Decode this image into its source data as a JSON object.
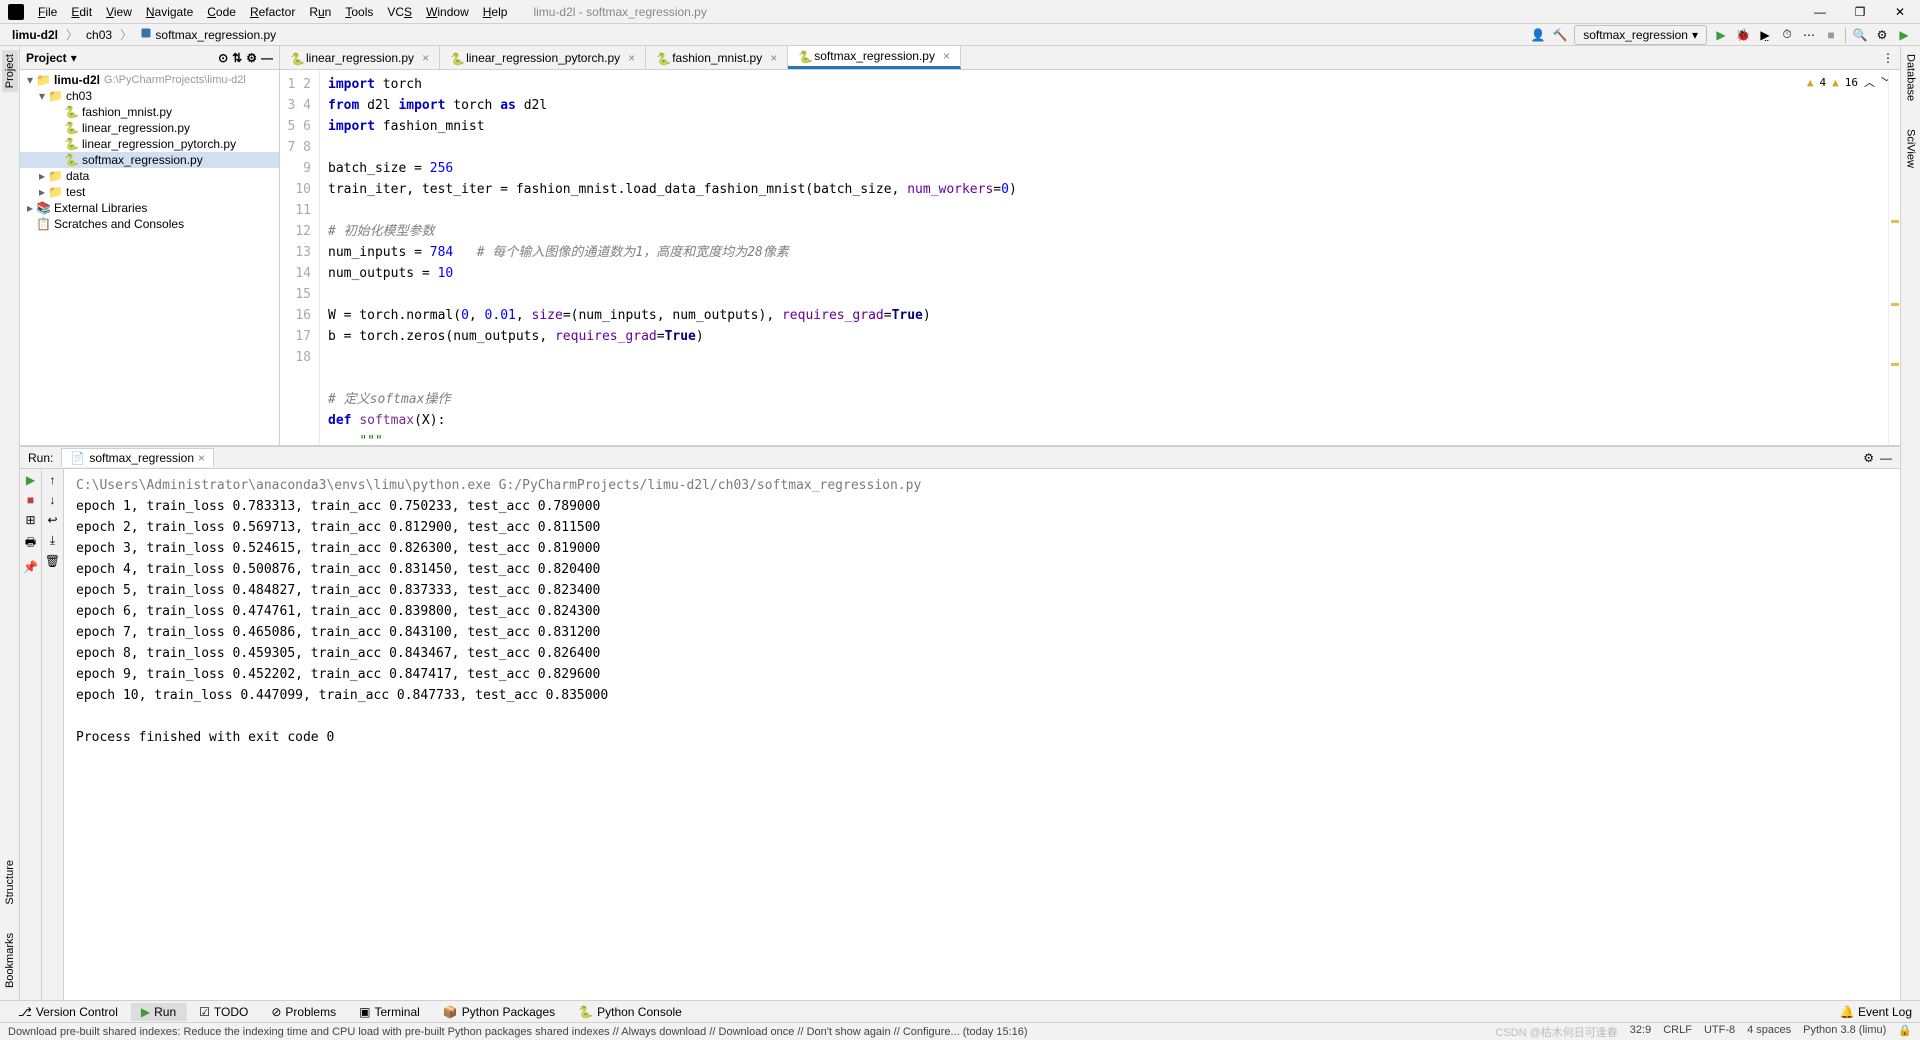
{
  "window": {
    "title": "limu-d2l - softmax_regression.py",
    "menus": [
      "File",
      "Edit",
      "View",
      "Navigate",
      "Code",
      "Refactor",
      "Run",
      "Tools",
      "VCS",
      "Window",
      "Help"
    ],
    "controls": {
      "minimize": "—",
      "maximize": "❐",
      "close": "✕"
    }
  },
  "breadcrumb": {
    "items": [
      "limu-d2l",
      "ch03",
      "softmax_regression.py"
    ]
  },
  "run_config": {
    "label": "softmax_regression"
  },
  "toolbar_icons": {
    "user": "user-icon",
    "run": "▶",
    "debug": "debug-icon",
    "coverage": "coverage-icon",
    "profile": "profile-icon",
    "stop": "■",
    "moreRun": "run-more-icon",
    "search": "search-icon",
    "settings": "gear-icon",
    "last": "execute-icon"
  },
  "project": {
    "title": "Project",
    "root": {
      "name": "limu-d2l",
      "path": "G:\\PyCharmProjects\\limu-d2l"
    },
    "ch03": {
      "name": "ch03",
      "files": [
        "fashion_mnist.py",
        "linear_regression.py",
        "linear_regression_pytorch.py",
        "softmax_regression.py"
      ]
    },
    "others": [
      "data",
      "test"
    ],
    "ext_lib": "External Libraries",
    "scratches": "Scratches and Consoles"
  },
  "tabs": [
    {
      "name": "linear_regression.py",
      "active": false
    },
    {
      "name": "linear_regression_pytorch.py",
      "active": false
    },
    {
      "name": "fashion_mnist.py",
      "active": false
    },
    {
      "name": "softmax_regression.py",
      "active": true
    }
  ],
  "editor": {
    "warnings": {
      "error": "4",
      "warn": "16"
    },
    "lines": [
      {
        "n": 1,
        "html": "<span class='kw'>import</span> torch"
      },
      {
        "n": 2,
        "html": "<span class='kw'>from</span> d2l <span class='kw'>import</span> torch <span class='kw'>as</span> d2l"
      },
      {
        "n": 3,
        "html": "<span class='kw'>import</span> fashion_mnist"
      },
      {
        "n": 4,
        "html": ""
      },
      {
        "n": 5,
        "html": "batch_size = <span class='num'>256</span>"
      },
      {
        "n": 6,
        "html": "train_iter, test_iter = fashion_mnist.load_data_fashion_mnist(batch_size, <span class='par'>num_workers</span>=<span class='num'>0</span>)"
      },
      {
        "n": 7,
        "html": ""
      },
      {
        "n": 8,
        "html": "<span class='cm'># 初始化模型参数</span>"
      },
      {
        "n": 9,
        "html": "num_inputs = <span class='num'>784</span>   <span class='cm'># 每个输入图像的通道数为1，高度和宽度均为28像素</span>"
      },
      {
        "n": 10,
        "html": "num_outputs = <span class='num'>10</span>"
      },
      {
        "n": 11,
        "html": ""
      },
      {
        "n": 12,
        "html": "W = torch.normal(<span class='num'>0</span>, <span class='num'>0.01</span>, <span class='par'>size</span>=(num_inputs, num_outputs), <span class='par'>requires_grad</span>=<span class='bool'>True</span>)"
      },
      {
        "n": 13,
        "html": "b = torch.zeros(num_outputs, <span class='par'>requires_grad</span>=<span class='bool'>True</span>)"
      },
      {
        "n": 14,
        "html": ""
      },
      {
        "n": 15,
        "html": ""
      },
      {
        "n": 16,
        "html": "<span class='cm'># 定义softmax操作</span>"
      },
      {
        "n": 17,
        "html": "<span class='kw'>def</span> <span class='fn'>softmax</span>(X):"
      },
      {
        "n": 18,
        "html": "    <span class='str'>\"\"\"</span>"
      }
    ]
  },
  "run": {
    "title": "Run:",
    "tab": "softmax_regression",
    "cmd": "C:\\Users\\Administrator\\anaconda3\\envs\\limu\\python.exe G:/PyCharmProjects/limu-d2l/ch03/softmax_regression.py",
    "epochs": [
      "epoch 1, train_loss 0.783313, train_acc 0.750233, test_acc 0.789000",
      "epoch 2, train_loss 0.569713, train_acc 0.812900, test_acc 0.811500",
      "epoch 3, train_loss 0.524615, train_acc 0.826300, test_acc 0.819000",
      "epoch 4, train_loss 0.500876, train_acc 0.831450, test_acc 0.820400",
      "epoch 5, train_loss 0.484827, train_acc 0.837333, test_acc 0.823400",
      "epoch 6, train_loss 0.474761, train_acc 0.839800, test_acc 0.824300",
      "epoch 7, train_loss 0.465086, train_acc 0.843100, test_acc 0.831200",
      "epoch 8, train_loss 0.459305, train_acc 0.843467, test_acc 0.826400",
      "epoch 9, train_loss 0.452202, train_acc 0.847417, test_acc 0.829600",
      "epoch 10, train_loss 0.447099, train_acc 0.847733, test_acc 0.835000"
    ],
    "done": "Process finished with exit code 0"
  },
  "bottom_tabs": {
    "vcs": "Version Control",
    "run": "Run",
    "todo": "TODO",
    "problems": "Problems",
    "terminal": "Terminal",
    "pypkg": "Python Packages",
    "pycon": "Python Console",
    "eventlog": "Event Log"
  },
  "left_tabs": {
    "structure": "Structure",
    "bookmarks": "Bookmarks",
    "project": "Project"
  },
  "right_tabs": {
    "database": "Database",
    "sciview": "SciView"
  },
  "status": {
    "msg": "Download pre-built shared indexes: Reduce the indexing time and CPU load with pre-built Python packages shared indexes // Always download // Download once // Don't show again // Configure... (today 15:16)",
    "pos": "32:9",
    "crlf": "CRLF",
    "enc": "UTF-8",
    "indent": "4 spaces",
    "python": "Python 3.8 (limu)",
    "watermark": "CSDN @枯木何日可逢春"
  }
}
